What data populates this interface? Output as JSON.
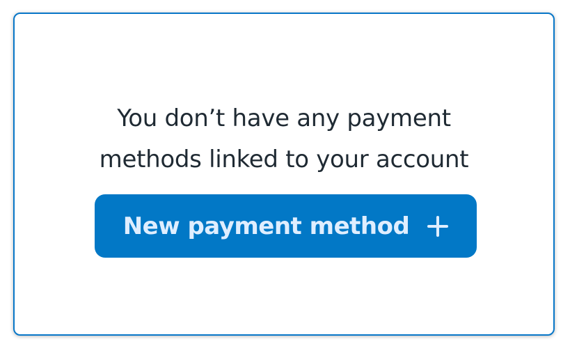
{
  "empty_state": {
    "message_line1": "You don’t have any payment",
    "message_line2": "methods linked to your account",
    "button_label": "New payment method",
    "button_icon": "plus-icon"
  },
  "colors": {
    "card_border": "#0877c8",
    "button_background": "#0278c6",
    "button_text": "#dfeeff",
    "message_text": "#1f2a33"
  }
}
